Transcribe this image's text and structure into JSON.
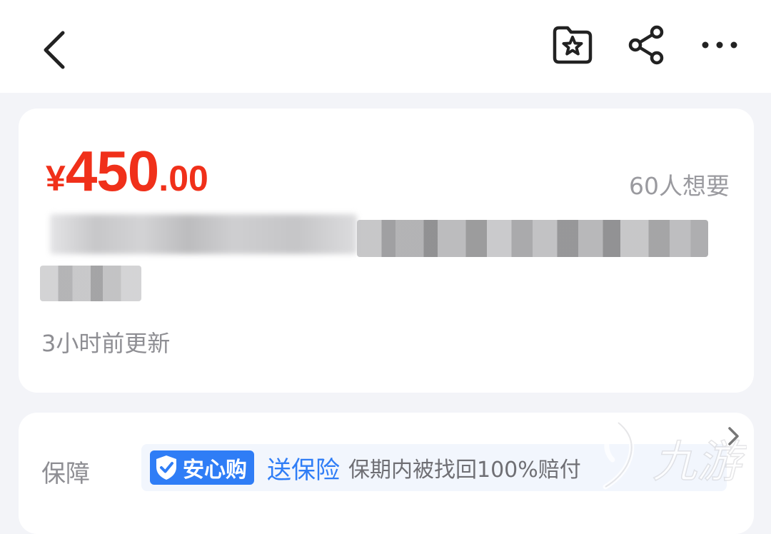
{
  "header": {
    "back_icon": "chevron-left-icon",
    "favorite_icon": "star-folder-icon",
    "share_icon": "share-icon",
    "more_icon": "more-horizontal-icon"
  },
  "product": {
    "currency": "¥",
    "price_integer": "450",
    "price_decimal": ".00",
    "want_count": "60人想要",
    "updated": "3小时前更新",
    "price_color": "#f0301a"
  },
  "guarantee": {
    "label": "保障",
    "badge": "安心购",
    "insurance": "送保险",
    "description": "保期内被找回100%赔付",
    "accent_color": "#2f7df6"
  },
  "watermark": {
    "text": "九游"
  }
}
